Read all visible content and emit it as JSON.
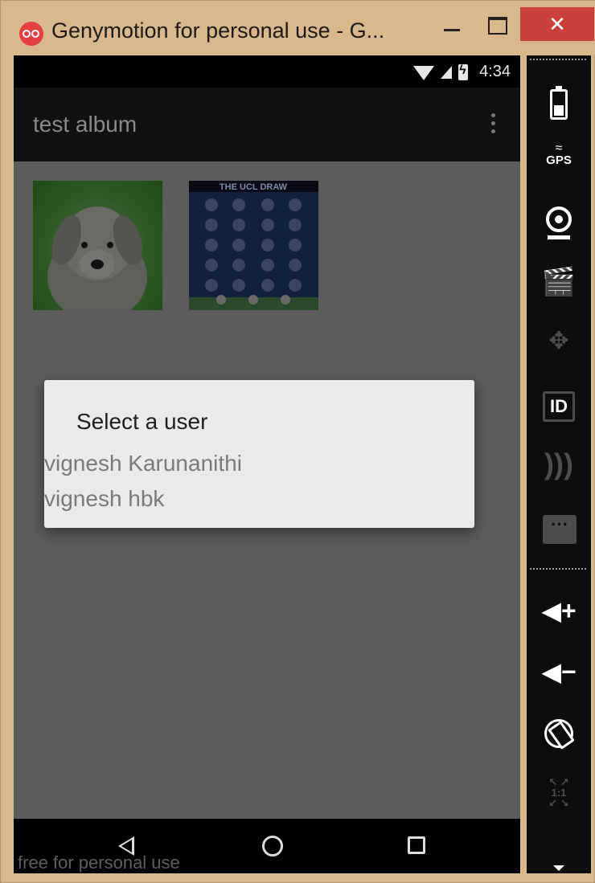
{
  "window": {
    "title": "Genymotion for personal use - G...",
    "minimize_icon": "minimize-icon",
    "maximize_icon": "maximize-icon",
    "close_label": "✕"
  },
  "statusbar": {
    "time": "4:34",
    "icons": [
      "wifi-icon",
      "signal-icon",
      "battery-charging-icon"
    ]
  },
  "appbar": {
    "title": "test album",
    "menu_icon": "overflow-menu-icon"
  },
  "gallery": {
    "thumbnails": [
      "puppy-photo",
      "the-ucl-draw-image"
    ],
    "thumb2_caption": "THE UCL DRAW"
  },
  "dialog": {
    "title": "Select a user",
    "items": [
      "vignesh Karunanithi",
      "vignesh hbk"
    ]
  },
  "navbar": {
    "icons": [
      "back-icon",
      "home-icon",
      "recent-apps-icon"
    ],
    "watermark": "free for personal use"
  },
  "sidebar": {
    "gps_label": "GPS",
    "id_label": "ID",
    "message_label": "···",
    "volume_up_label": "◀+",
    "volume_down_label": "◀−",
    "scale_label": "1:1"
  },
  "colors": {
    "title_bar": "#d9b98c",
    "close_button": "#c8413b",
    "screen_dim": "#5c5c5c",
    "dialog_bg": "#eaeaea"
  }
}
